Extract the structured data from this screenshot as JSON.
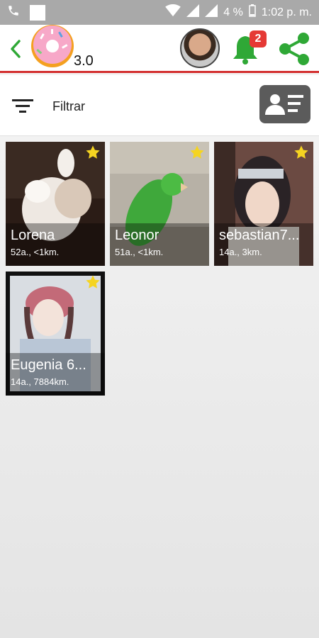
{
  "status_bar": {
    "battery": "4 %",
    "time": "1:02 p. m."
  },
  "header": {
    "logo_version": "3.0",
    "notifications_count": "2",
    "colors": {
      "accent": "#d32f2f",
      "green": "#2fa836",
      "badge": "#e53935"
    },
    "icons": [
      "back-icon",
      "donut-logo",
      "bell-icon",
      "share-icon"
    ]
  },
  "filter": {
    "label": "Filtrar",
    "icons": [
      "filter-icon",
      "contact-card-icon"
    ]
  },
  "profiles": [
    {
      "name": "Lorena",
      "meta": "52a., <1km."
    },
    {
      "name": "Leonor",
      "meta": "51a., <1km."
    },
    {
      "name": "sebastian7...",
      "meta": "14a., 3km."
    },
    {
      "name": "Eugenia 6...",
      "meta": "14a., 7884km."
    }
  ]
}
